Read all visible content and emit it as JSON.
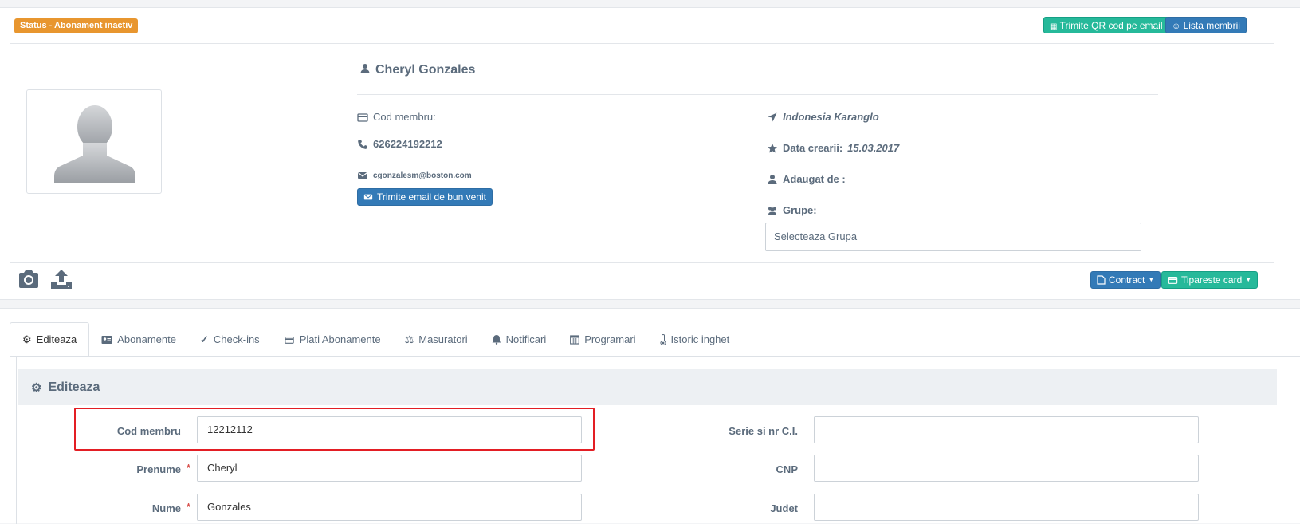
{
  "header": {
    "status_badge": "Status - Abonament inactiv",
    "qr_button": "Trimite QR cod pe email",
    "members_button": "Lista membrii"
  },
  "profile": {
    "name": "Cheryl Gonzales",
    "member_code_label": "Cod membru:",
    "phone": "626224192212",
    "email": "cgonzalesm@boston.com",
    "welcome_button": "Trimite email de bun venit",
    "location": "Indonesia Karanglo",
    "created_label": "Data crearii:",
    "created_value": "15.03.2017",
    "added_by_label": "Adaugat de :",
    "groups_label": "Grupe:",
    "groups_placeholder": "Selecteaza Grupa"
  },
  "actions": {
    "contract_button": "Contract",
    "print_card_button": "Tipareste card"
  },
  "tabs": [
    {
      "label": "Editeaza",
      "icon": "cog-icon"
    },
    {
      "label": "Abonamente",
      "icon": "id-card-icon"
    },
    {
      "label": "Check-ins",
      "icon": "check-icon"
    },
    {
      "label": "Plati Abonamente",
      "icon": "credit-card-icon"
    },
    {
      "label": "Masuratori",
      "icon": "balance-scale-icon"
    },
    {
      "label": "Notificari",
      "icon": "bell-icon"
    },
    {
      "label": "Programari",
      "icon": "calendar-icon"
    },
    {
      "label": "Istoric inghet",
      "icon": "thermometer-icon"
    }
  ],
  "edit_panel": {
    "title": "Editeaza",
    "fields_left": [
      {
        "label": "Cod membru",
        "value": "12212112",
        "required": false
      },
      {
        "label": "Prenume",
        "value": "Cheryl",
        "required": true
      },
      {
        "label": "Nume",
        "value": "Gonzales",
        "required": true
      }
    ],
    "fields_right": [
      {
        "label": "Serie si nr C.I.",
        "value": ""
      },
      {
        "label": "CNP",
        "value": ""
      },
      {
        "label": "Judet",
        "value": ""
      }
    ],
    "required_mark": "*"
  },
  "colors": {
    "status_orange": "#e8962f",
    "accent_green": "#26b99a",
    "accent_blue": "#337ab7",
    "highlight_red": "#e31e24"
  }
}
